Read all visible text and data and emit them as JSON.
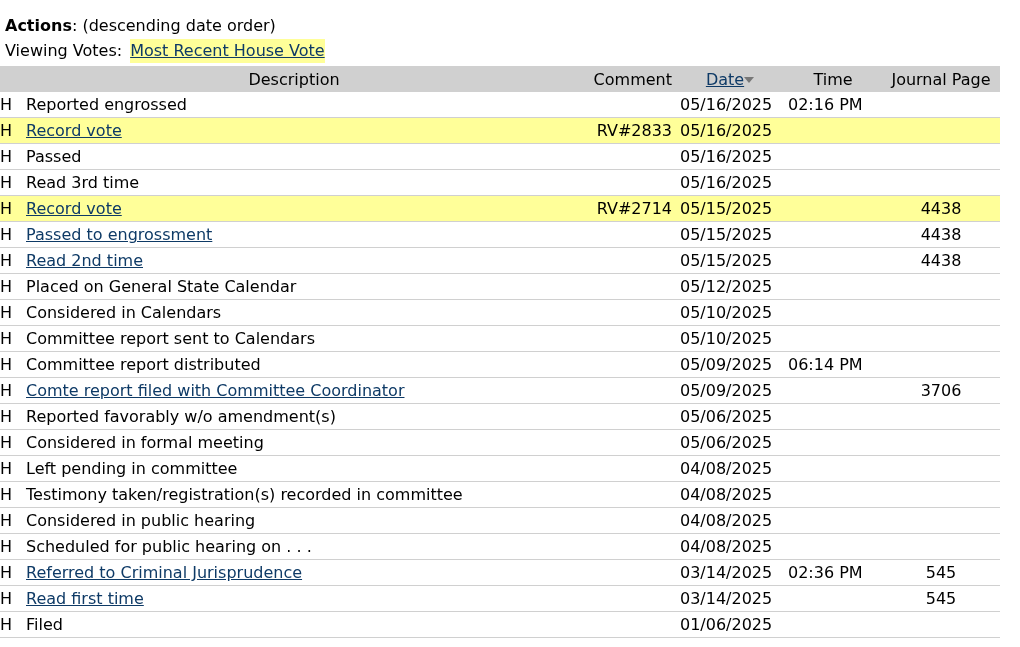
{
  "heading": "**Actions**: (descending date order)",
  "viewing_votes": {
    "label": "Viewing Votes:",
    "link": "Most Recent House Vote"
  },
  "table": {
    "columns": [
      {
        "label": "Description",
        "link": false,
        "sorted": false
      },
      {
        "label": "Comment",
        "link": false,
        "sorted": false
      },
      {
        "label": "Date",
        "link": true,
        "sorted": true
      },
      {
        "label": "Time",
        "link": false,
        "sorted": false
      },
      {
        "label": "Journal Page",
        "link": false,
        "sorted": false
      }
    ],
    "rows": [
      {
        "chamber": "H",
        "description": "Reported engrossed",
        "link": false,
        "comment": "",
        "date": "05/16/2025",
        "time": "02:16 PM",
        "journal_page": "",
        "highlighted": false
      },
      {
        "chamber": "H",
        "description": "Record vote",
        "link": true,
        "comment": "RV#2833",
        "date": "05/16/2025",
        "time": "",
        "journal_page": "",
        "highlighted": true
      },
      {
        "chamber": "H",
        "description": "Passed",
        "link": false,
        "comment": "",
        "date": "05/16/2025",
        "time": "",
        "journal_page": "",
        "highlighted": false
      },
      {
        "chamber": "H",
        "description": "Read 3rd time",
        "link": false,
        "comment": "",
        "date": "05/16/2025",
        "time": "",
        "journal_page": "",
        "highlighted": false
      },
      {
        "chamber": "H",
        "description": "Record vote",
        "link": true,
        "comment": "RV#2714",
        "date": "05/15/2025",
        "time": "",
        "journal_page": "4438",
        "highlighted": true
      },
      {
        "chamber": "H",
        "description": "Passed to engrossment",
        "link": true,
        "comment": "",
        "date": "05/15/2025",
        "time": "",
        "journal_page": "4438",
        "highlighted": false
      },
      {
        "chamber": "H",
        "description": "Read 2nd time",
        "link": true,
        "comment": "",
        "date": "05/15/2025",
        "time": "",
        "journal_page": "4438",
        "highlighted": false
      },
      {
        "chamber": "H",
        "description": "Placed on General State Calendar",
        "link": false,
        "comment": "",
        "date": "05/12/2025",
        "time": "",
        "journal_page": "",
        "highlighted": false
      },
      {
        "chamber": "H",
        "description": "Considered in Calendars",
        "link": false,
        "comment": "",
        "date": "05/10/2025",
        "time": "",
        "journal_page": "",
        "highlighted": false
      },
      {
        "chamber": "H",
        "description": "Committee report sent to Calendars",
        "link": false,
        "comment": "",
        "date": "05/10/2025",
        "time": "",
        "journal_page": "",
        "highlighted": false
      },
      {
        "chamber": "H",
        "description": "Committee report distributed",
        "link": false,
        "comment": "",
        "date": "05/09/2025",
        "time": "06:14 PM",
        "journal_page": "",
        "highlighted": false
      },
      {
        "chamber": "H",
        "description": "Comte report filed with Committee Coordinator",
        "link": true,
        "comment": "",
        "date": "05/09/2025",
        "time": "",
        "journal_page": "3706",
        "highlighted": false
      },
      {
        "chamber": "H",
        "description": "Reported favorably w/o amendment(s)",
        "link": false,
        "comment": "",
        "date": "05/06/2025",
        "time": "",
        "journal_page": "",
        "highlighted": false
      },
      {
        "chamber": "H",
        "description": "Considered in formal meeting",
        "link": false,
        "comment": "",
        "date": "05/06/2025",
        "time": "",
        "journal_page": "",
        "highlighted": false
      },
      {
        "chamber": "H",
        "description": "Left pending in committee",
        "link": false,
        "comment": "",
        "date": "04/08/2025",
        "time": "",
        "journal_page": "",
        "highlighted": false
      },
      {
        "chamber": "H",
        "description": "Testimony taken/registration(s) recorded in committee",
        "link": false,
        "comment": "",
        "date": "04/08/2025",
        "time": "",
        "journal_page": "",
        "highlighted": false
      },
      {
        "chamber": "H",
        "description": "Considered in public hearing",
        "link": false,
        "comment": "",
        "date": "04/08/2025",
        "time": "",
        "journal_page": "",
        "highlighted": false
      },
      {
        "chamber": "H",
        "description": "Scheduled for public hearing on . . .",
        "link": false,
        "comment": "",
        "date": "04/08/2025",
        "time": "",
        "journal_page": "",
        "highlighted": false
      },
      {
        "chamber": "H",
        "description": "Referred to Criminal Jurisprudence",
        "link": true,
        "comment": "",
        "date": "03/14/2025",
        "time": "02:36 PM",
        "journal_page": "545",
        "highlighted": false
      },
      {
        "chamber": "H",
        "description": "Read first time",
        "link": true,
        "comment": "",
        "date": "03/14/2025",
        "time": "",
        "journal_page": "545",
        "highlighted": false
      },
      {
        "chamber": "H",
        "description": "Filed",
        "link": false,
        "comment": "",
        "date": "01/06/2025",
        "time": "",
        "journal_page": "",
        "highlighted": false
      }
    ]
  }
}
